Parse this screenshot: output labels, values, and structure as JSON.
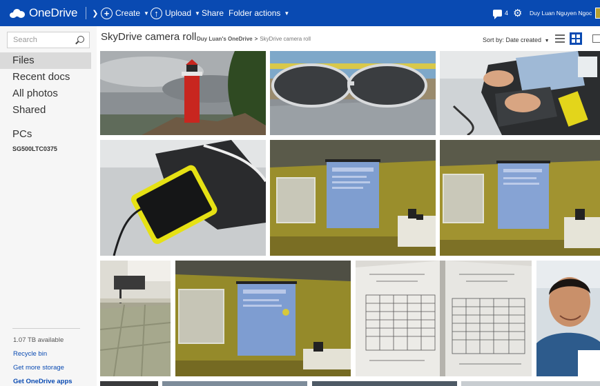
{
  "topbar": {
    "brand": "OneDrive",
    "create_label": "Create",
    "upload_label": "Upload",
    "share_label": "Share",
    "folder_actions_label": "Folder actions",
    "notifications_count": "4",
    "user_name": "Duy Luan Nguyen Ngoc"
  },
  "sidebar": {
    "search_placeholder": "Search",
    "nav": [
      {
        "label": "Files",
        "active": true
      },
      {
        "label": "Recent docs"
      },
      {
        "label": "All photos"
      },
      {
        "label": "Shared"
      }
    ],
    "pcs_heading": "PCs",
    "pc_name": "SG500LTC0375",
    "storage": "1.07 TB available",
    "links": [
      "Recycle bin",
      "Get more storage",
      "Get OneDrive apps"
    ]
  },
  "main": {
    "title": "SkyDrive camera roll",
    "breadcrumb": [
      "Duy Luan's OneDrive",
      "SkyDrive camera roll"
    ],
    "sort_label": "Sort by: Date created"
  },
  "colors": {
    "brand_blue": "#094ab2",
    "sidebar_bg": "#f6f6f6",
    "link_blue": "#094ab2"
  }
}
